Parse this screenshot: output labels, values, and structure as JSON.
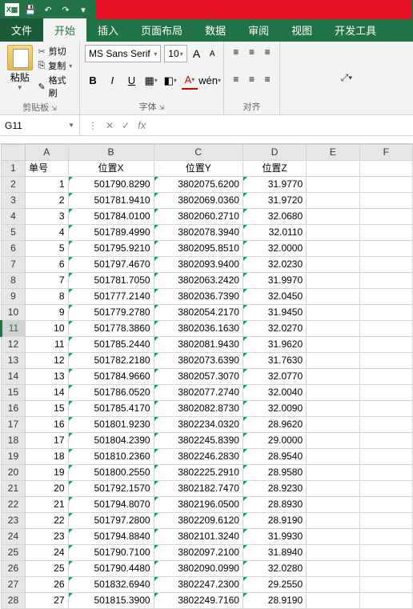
{
  "qat": {
    "excel": "X▦",
    "save": "💾",
    "undo": "↶",
    "redo": "↷"
  },
  "tabs": {
    "file": "文件",
    "home": "开始",
    "insert": "插入",
    "layout": "页面布局",
    "data": "数据",
    "review": "审阅",
    "view": "视图",
    "dev": "开发工具"
  },
  "ribbon": {
    "paste": "粘贴",
    "cut": "剪切",
    "copy": "复制",
    "format_painter": "格式刷",
    "clipboard": "剪贴板",
    "font_name": "MS Sans Serif",
    "font_size": "10",
    "font_group": "字体",
    "align_group": "对齐",
    "bold": "B",
    "italic": "I",
    "underline": "U",
    "grow_a": "A",
    "shrink_a": "A"
  },
  "namebox": "G11",
  "fx": "fx",
  "columns": [
    "A",
    "B",
    "C",
    "D",
    "E",
    "F"
  ],
  "headers": {
    "A": "单号",
    "B": "位置X",
    "C": "位置Y",
    "D": "位置Z"
  },
  "rows": [
    {
      "n": 1,
      "a": "1",
      "b": "501790.8290",
      "c": "3802075.6200",
      "d": "31.9770"
    },
    {
      "n": 2,
      "a": "2",
      "b": "501781.9410",
      "c": "3802069.0360",
      "d": "31.9720"
    },
    {
      "n": 3,
      "a": "3",
      "b": "501784.0100",
      "c": "3802060.2710",
      "d": "32.0680"
    },
    {
      "n": 4,
      "a": "4",
      "b": "501789.4990",
      "c": "3802078.3940",
      "d": "32.0110"
    },
    {
      "n": 5,
      "a": "5",
      "b": "501795.9210",
      "c": "3802095.8510",
      "d": "32.0000"
    },
    {
      "n": 6,
      "a": "6",
      "b": "501797.4670",
      "c": "3802093.9400",
      "d": "32.0230"
    },
    {
      "n": 7,
      "a": "7",
      "b": "501781.7050",
      "c": "3802063.2420",
      "d": "31.9970"
    },
    {
      "n": 8,
      "a": "8",
      "b": "501777.2140",
      "c": "3802036.7390",
      "d": "32.0450"
    },
    {
      "n": 9,
      "a": "9",
      "b": "501779.2780",
      "c": "3802054.2170",
      "d": "31.9450"
    },
    {
      "n": 10,
      "a": "10",
      "b": "501778.3860",
      "c": "3802036.1630",
      "d": "32.0270"
    },
    {
      "n": 11,
      "a": "11",
      "b": "501785.2440",
      "c": "3802081.9430",
      "d": "31.9620"
    },
    {
      "n": 12,
      "a": "12",
      "b": "501782.2180",
      "c": "3802073.6390",
      "d": "31.7630"
    },
    {
      "n": 13,
      "a": "13",
      "b": "501784.9660",
      "c": "3802057.3070",
      "d": "32.0770"
    },
    {
      "n": 14,
      "a": "14",
      "b": "501786.0520",
      "c": "3802077.2740",
      "d": "32.0040"
    },
    {
      "n": 15,
      "a": "15",
      "b": "501785.4170",
      "c": "3802082.8730",
      "d": "32.0090"
    },
    {
      "n": 16,
      "a": "16",
      "b": "501801.9230",
      "c": "3802234.0320",
      "d": "28.9620"
    },
    {
      "n": 17,
      "a": "17",
      "b": "501804.2390",
      "c": "3802245.8390",
      "d": "29.0000"
    },
    {
      "n": 18,
      "a": "18",
      "b": "501810.2360",
      "c": "3802246.2830",
      "d": "28.9540"
    },
    {
      "n": 19,
      "a": "19",
      "b": "501800.2550",
      "c": "3802225.2910",
      "d": "28.9580"
    },
    {
      "n": 20,
      "a": "20",
      "b": "501792.1570",
      "c": "3802182.7470",
      "d": "28.9230"
    },
    {
      "n": 21,
      "a": "21",
      "b": "501794.8070",
      "c": "3802196.0500",
      "d": "28.8930"
    },
    {
      "n": 22,
      "a": "22",
      "b": "501797.2800",
      "c": "3802209.6120",
      "d": "28.9190"
    },
    {
      "n": 23,
      "a": "23",
      "b": "501794.8840",
      "c": "3802101.3240",
      "d": "31.9930"
    },
    {
      "n": 24,
      "a": "24",
      "b": "501790.7100",
      "c": "3802097.2100",
      "d": "31.8940"
    },
    {
      "n": 25,
      "a": "25",
      "b": "501790.4480",
      "c": "3802090.0990",
      "d": "32.0280"
    },
    {
      "n": 26,
      "a": "26",
      "b": "501832.6940",
      "c": "3802247.2300",
      "d": "29.2550"
    },
    {
      "n": 27,
      "a": "27",
      "b": "501815.3900",
      "c": "3802249.7160",
      "d": "28.9190"
    }
  ],
  "selected_row": 11
}
